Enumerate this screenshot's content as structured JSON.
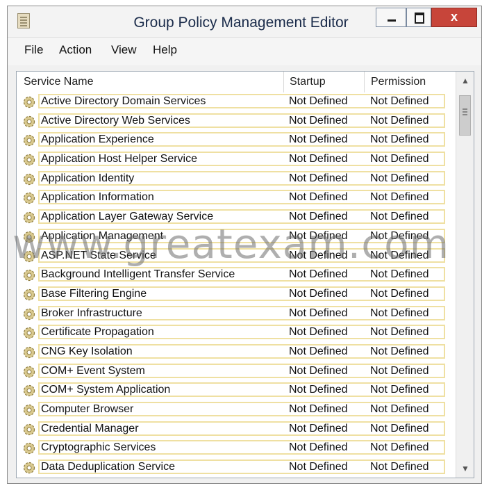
{
  "window": {
    "title": "Group Policy Management Editor",
    "close_glyph": "x"
  },
  "menu": {
    "file": "File",
    "action": "Action",
    "view": "View",
    "help": "Help"
  },
  "columns": {
    "name": "Service Name",
    "startup": "Startup",
    "permission": "Permission"
  },
  "services": [
    {
      "name": "Active Directory Domain Services",
      "startup": "Not Defined",
      "permission": "Not Defined"
    },
    {
      "name": "Active Directory Web Services",
      "startup": "Not Defined",
      "permission": "Not Defined"
    },
    {
      "name": "Application Experience",
      "startup": "Not Defined",
      "permission": "Not Defined"
    },
    {
      "name": "Application Host Helper Service",
      "startup": "Not Defined",
      "permission": "Not Defined"
    },
    {
      "name": "Application Identity",
      "startup": "Not Defined",
      "permission": "Not Defined"
    },
    {
      "name": "Application Information",
      "startup": "Not Defined",
      "permission": "Not Defined"
    },
    {
      "name": "Application Layer Gateway Service",
      "startup": "Not Defined",
      "permission": "Not Defined"
    },
    {
      "name": "Application Management",
      "startup": "Not Defined",
      "permission": "Not Defined"
    },
    {
      "name": "ASP.NET State Service",
      "startup": "Not Defined",
      "permission": "Not Defined"
    },
    {
      "name": "Background Intelligent Transfer Service",
      "startup": "Not Defined",
      "permission": "Not Defined"
    },
    {
      "name": "Base Filtering Engine",
      "startup": "Not Defined",
      "permission": "Not Defined"
    },
    {
      "name": "Broker Infrastructure",
      "startup": "Not Defined",
      "permission": "Not Defined"
    },
    {
      "name": "Certificate Propagation",
      "startup": "Not Defined",
      "permission": "Not Defined"
    },
    {
      "name": "CNG Key Isolation",
      "startup": "Not Defined",
      "permission": "Not Defined"
    },
    {
      "name": "COM+ Event System",
      "startup": "Not Defined",
      "permission": "Not Defined"
    },
    {
      "name": "COM+ System Application",
      "startup": "Not Defined",
      "permission": "Not Defined"
    },
    {
      "name": "Computer Browser",
      "startup": "Not Defined",
      "permission": "Not Defined"
    },
    {
      "name": "Credential Manager",
      "startup": "Not Defined",
      "permission": "Not Defined"
    },
    {
      "name": "Cryptographic Services",
      "startup": "Not Defined",
      "permission": "Not Defined"
    },
    {
      "name": "Data Deduplication Service",
      "startup": "Not Defined",
      "permission": "Not Defined"
    }
  ],
  "icons": {
    "window": "policy-editor-icon",
    "row": "service-gear-icon",
    "scroll_up": "chevron-up-icon",
    "scroll_down": "chevron-down-icon"
  },
  "colors": {
    "close_button": "#c7453a",
    "row_highlight_border": "#efe0a2"
  },
  "watermark": "www.greatexam.com"
}
